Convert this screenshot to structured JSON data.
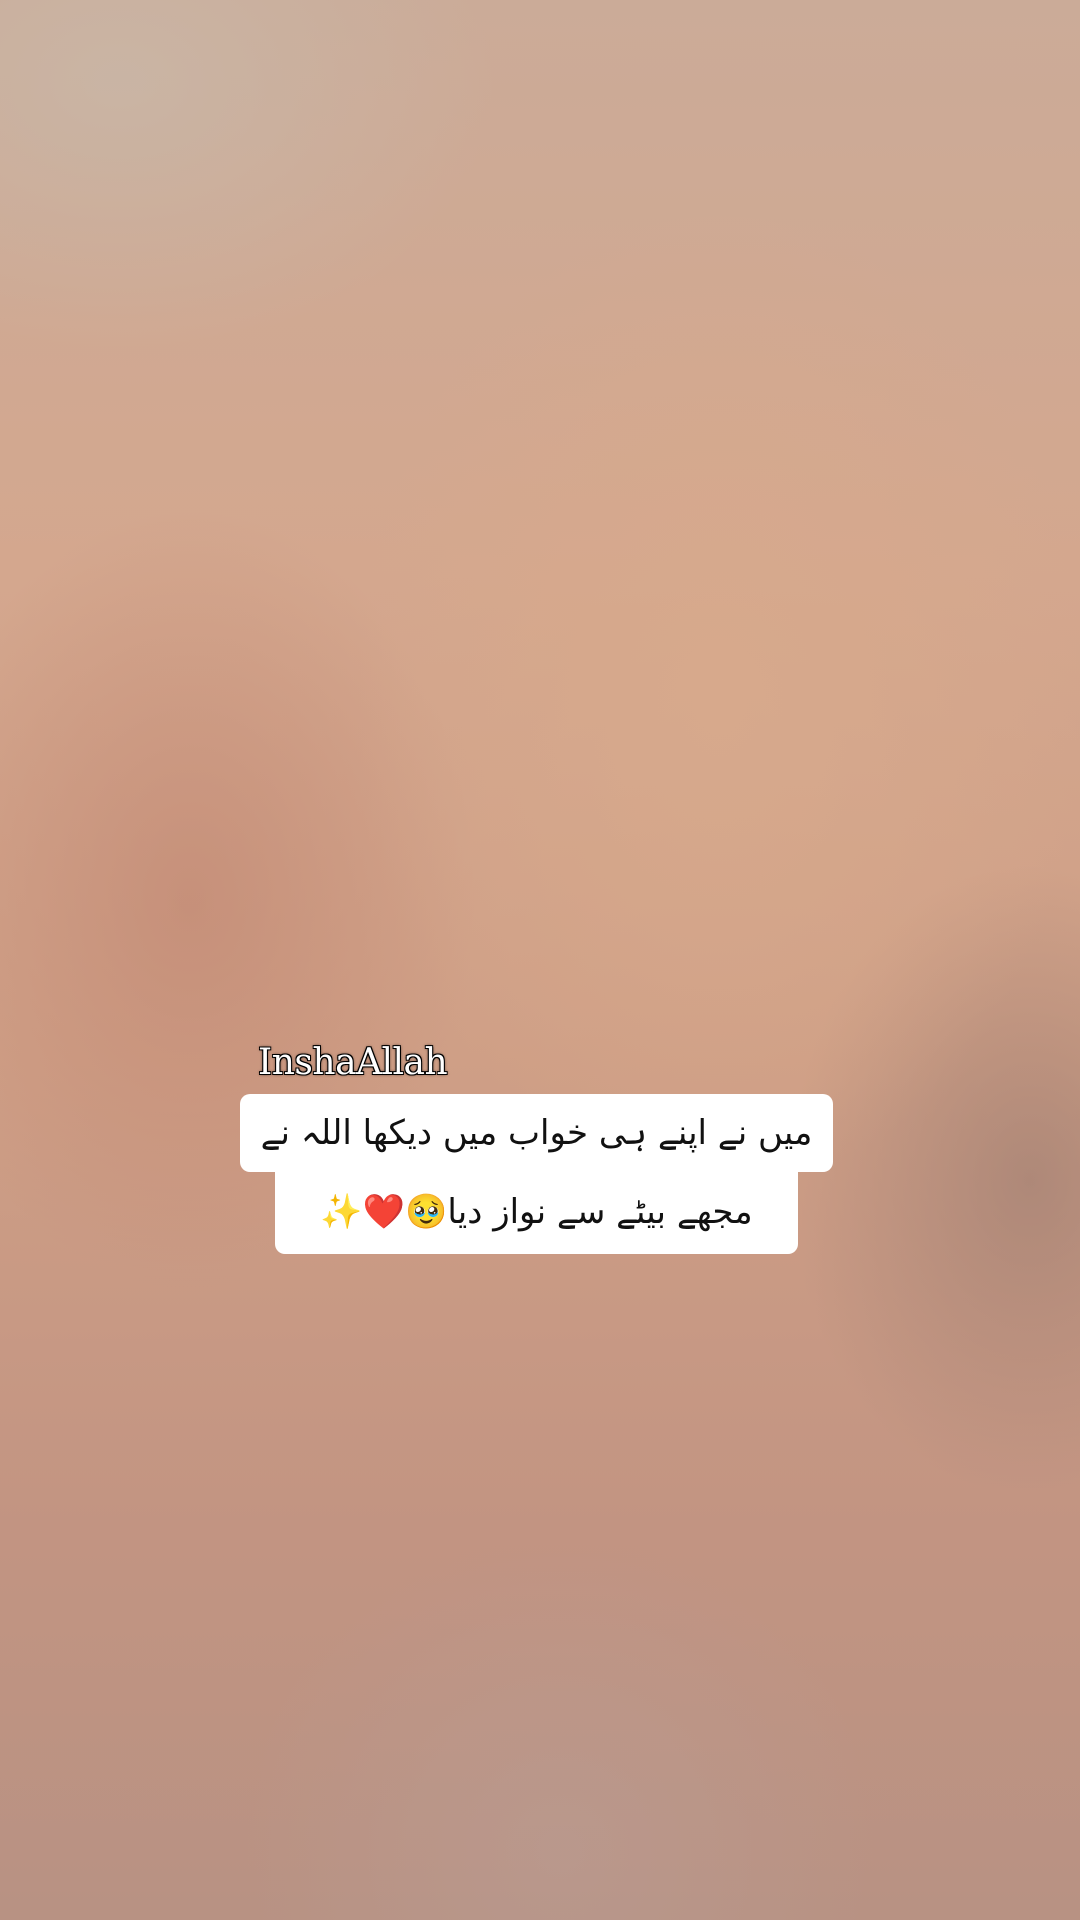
{
  "overlay": {
    "tag_text": "InshaAllah",
    "caption_lines": [
      "میں نے اپنے ہی خواب میں دیکھا اللہ نے",
      "مجھے بیٹے سے نواز دیا🥹❤️✨"
    ]
  },
  "colors": {
    "caption_background": "#ffffff",
    "caption_text": "#111111",
    "tag_text": "#ffffff",
    "tag_outline": "#000000"
  }
}
